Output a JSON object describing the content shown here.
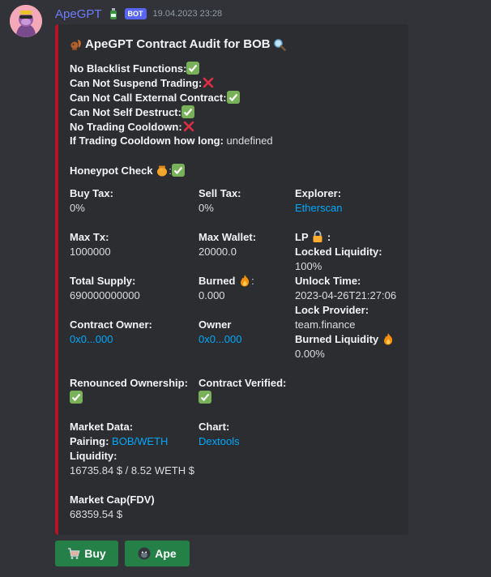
{
  "message": {
    "username": "ApeGPT",
    "bot_badge": "BOT",
    "timestamp": "19.04.2023 23:28"
  },
  "embed": {
    "accent_color": "#b5142a",
    "title": "ApeGPT Contract Audit for BOB",
    "checks": [
      {
        "label": "No Blacklist Functions:",
        "status": "check"
      },
      {
        "label": "Can Not Suspend Trading:",
        "status": "cross"
      },
      {
        "label": "Can Not Call External Contract:",
        "status": "check"
      },
      {
        "label": "Can Not Self Destruct:",
        "status": "check"
      },
      {
        "label": "No Trading Cooldown:",
        "status": "cross"
      }
    ],
    "cooldown": {
      "label": "If Trading Cooldown how long:",
      "value": "undefined"
    },
    "honeypot": {
      "label": "Honeypot Check",
      "sep": ":"
    },
    "buy_tax": {
      "label": "Buy Tax:",
      "value": "0%"
    },
    "sell_tax": {
      "label": "Sell Tax:",
      "value": "0%"
    },
    "explorer": {
      "label": "Explorer:",
      "value": "Etherscan"
    },
    "max_tx": {
      "label": "Max Tx:",
      "value": "1000000"
    },
    "max_wallet": {
      "label": "Max Wallet:",
      "value": "20000.0"
    },
    "lp": {
      "label": "LP",
      "sep": ":"
    },
    "locked_liquidity": {
      "label": "Locked Liquidity:",
      "value": "100%"
    },
    "total_supply": {
      "label": "Total Supply:",
      "value": "690000000000"
    },
    "burned": {
      "label": "Burned",
      "sep": ":",
      "value": "0.000"
    },
    "unlock_time": {
      "label": "Unlock Time:",
      "value": "2023-04-26T21:27:06"
    },
    "lock_provider": {
      "label": "Lock Provider:",
      "value": "team.finance"
    },
    "contract_owner": {
      "label": "Contract Owner:",
      "value": "0x0...000"
    },
    "owner": {
      "label": "Owner",
      "value": "0x0...000"
    },
    "burned_liquidity": {
      "label": "Burned Liquidity",
      "value": "0.00%"
    },
    "renounced": {
      "label": "Renounced Ownership:"
    },
    "verified": {
      "label": "Contract Verified:"
    },
    "market_data": {
      "label": "Market Data:"
    },
    "pairing": {
      "label": "Pairing:",
      "value": "BOB/WETH"
    },
    "liquidity": {
      "label": "Liquidity:",
      "value": "16735.84 $ / 8.52 WETH $"
    },
    "chart": {
      "label": "Chart:",
      "value": "Dextools"
    },
    "market_cap": {
      "label": "Market Cap(FDV)",
      "value": "68359.54 $"
    }
  },
  "buttons": {
    "buy": "Buy",
    "ape": "Ape",
    "color": "#248046"
  }
}
